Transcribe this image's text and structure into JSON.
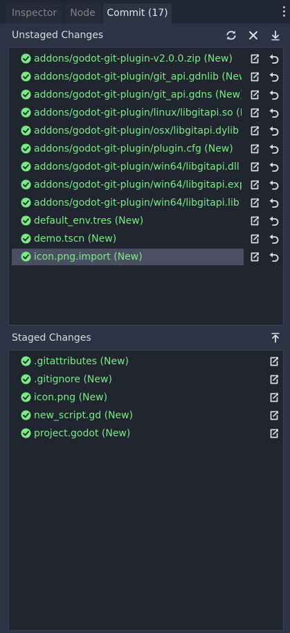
{
  "tabs": [
    {
      "label": "Inspector"
    },
    {
      "label": "Node"
    },
    {
      "label": "Commit (17)"
    }
  ],
  "unstaged": {
    "title": "Unstaged Changes",
    "refresh_icon": "refresh-icon",
    "discard_all_icon": "close-icon",
    "stage_all_icon": "arrow-down-icon",
    "items": [
      {
        "label": "addons/godot-git-plugin-v2.0.0.zip (New)"
      },
      {
        "label": "addons/godot-git-plugin/git_api.gdnlib (New"
      },
      {
        "label": "addons/godot-git-plugin/git_api.gdns (New)"
      },
      {
        "label": "addons/godot-git-plugin/linux/libgitapi.so (N"
      },
      {
        "label": "addons/godot-git-plugin/osx/libgitapi.dylib ("
      },
      {
        "label": "addons/godot-git-plugin/plugin.cfg (New)"
      },
      {
        "label": "addons/godot-git-plugin/win64/libgitapi.dll ("
      },
      {
        "label": "addons/godot-git-plugin/win64/libgitapi.exp"
      },
      {
        "label": "addons/godot-git-plugin/win64/libgitapi.lib ("
      },
      {
        "label": "default_env.tres (New)"
      },
      {
        "label": "demo.tscn (New)"
      },
      {
        "label": "icon.png.import (New)"
      }
    ],
    "selected_index": 11
  },
  "staged": {
    "title": "Staged Changes",
    "unstage_all_icon": "arrow-up-icon",
    "items": [
      {
        "label": ".gitattributes (New)"
      },
      {
        "label": ".gitignore (New)"
      },
      {
        "label": "icon.png (New)"
      },
      {
        "label": "new_script.gd (New)"
      },
      {
        "label": "project.godot (New)"
      }
    ]
  },
  "colors": {
    "background": "#2c3345",
    "panel": "#20252f",
    "new_file_text": "#7bea84",
    "selected_row": "#4a5061",
    "icon": "#dfe1e5"
  }
}
